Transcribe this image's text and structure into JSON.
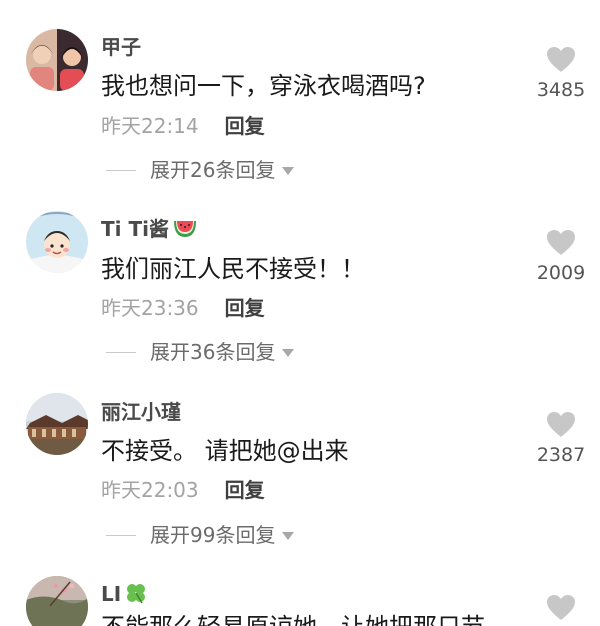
{
  "comments": [
    {
      "username": "甲子",
      "text": "我也想问一下，穿泳衣喝酒吗?",
      "time": "昨天22:14",
      "reply_label": "回复",
      "expand_label": "展开26条回复",
      "likes": "3485"
    },
    {
      "username": "Ti Ti酱",
      "badge_icon": "watermelon-icon",
      "text": "我们丽江人民不接受！！",
      "time": "昨天23:36",
      "reply_label": "回复",
      "expand_label": "展开36条回复",
      "likes": "2009"
    },
    {
      "username": "丽江小瑾",
      "text": "不接受。 请把她@出来",
      "time": "昨天22:03",
      "reply_label": "回复",
      "expand_label": "展开99条回复",
      "likes": "2387"
    },
    {
      "username": "LI",
      "badge_icon": "four-leaf-clover-icon",
      "text": "不能那么轻易原谅她，让她把那只节",
      "likes": ""
    }
  ],
  "icons": {
    "like": "heart-icon",
    "expand": "caret-down-icon"
  },
  "colors": {
    "heart": "#c7c7c7",
    "username": "#4a4a4a",
    "time": "#a3a3a3"
  }
}
